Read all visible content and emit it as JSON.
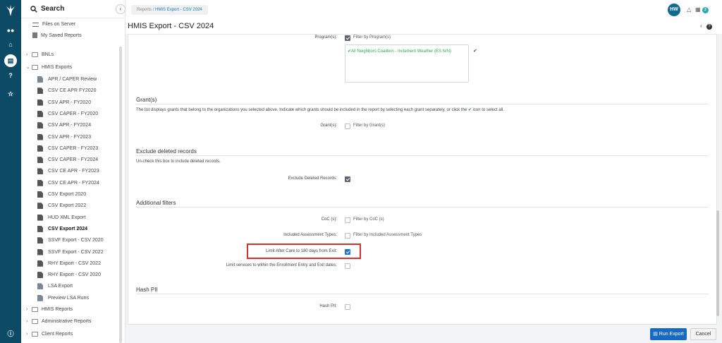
{
  "sidebar": {
    "search_label": "Search",
    "top_items": [
      "Files on Server",
      "My Saved Reports"
    ],
    "folders": {
      "bnls": "BNLs",
      "hmis_exports": "HMIS Exports",
      "hmis_reports": "HMIS Reports",
      "administrative_reports": "Administrative Reports",
      "client_reports": "Client Reports"
    },
    "export_items": [
      "APR / CAPER Review",
      "CSV CE APR FY2020",
      "CSV APR - FY2020",
      "CSV CAPER - FY2020",
      "CSV APR - FY2024",
      "CSV APR - FY2023",
      "CSV CAPER - FY2023",
      "CSV CAPER - FY2024",
      "CSV CE APR - FY2023",
      "CSV CE APR - FY2024",
      "CSV Export 2020",
      "CSV Export 2022",
      "HUD XML Export",
      "CSV Export 2024",
      "SSVF Export - CSV 2020",
      "SSVF Export - CSV 2022",
      "RHY Export - CSV 2022",
      "RHY Export - CSV 2020",
      "LSA Export",
      "Preview LSA Runs"
    ],
    "active_item": "CSV Export 2024"
  },
  "header": {
    "breadcrumb_root": "Reports",
    "breadcrumb_sep": "/",
    "breadcrumb_current": "HMIS Export - CSV 2024",
    "avatar_initials": "HW",
    "badge": "2"
  },
  "page": {
    "title": "HMIS Export - CSV 2024"
  },
  "form": {
    "programs_label": "Program(s):",
    "programs_filter": "Filter by Program(s)",
    "program_selected": "✔All Neighbors Coalition - Inclement Weather (ES N/N)",
    "grants": {
      "heading": "Grant(s)",
      "description": "The list displays grants that belong to the organizations you selected above. Indicate which grants should be included in the report by selecting each grant separately, or click the",
      "description_end": "icon to select all.",
      "label": "Grant(s):",
      "filter": "Filter by Grant(s)"
    },
    "deleted": {
      "heading": "Exclude deleted records",
      "description": "Un-check this box to include deleted records.",
      "label": "Exclude Deleted Records:"
    },
    "additional": {
      "heading": "Additional filters",
      "coc_label": "CoC (s):",
      "coc_filter": "Filter by CoC (s)",
      "assess_label": "Included Assessment Types:",
      "assess_filter": "Filter by Included Assessment Types",
      "limit_label": "Limit After Care to 180 days from Exit:",
      "services_label": "Limit services to within the Enrollment Entry and Exit dates:"
    },
    "hash": {
      "heading": "Hash PII",
      "label": "Hash PII:"
    }
  },
  "footer": {
    "run_label": "Run Export",
    "cancel_label": "Cancel"
  },
  "colors": {
    "rail": "#0d4a66",
    "accent": "#1769c2",
    "highlight": "#d9302c",
    "program_green": "#2aa84a"
  }
}
